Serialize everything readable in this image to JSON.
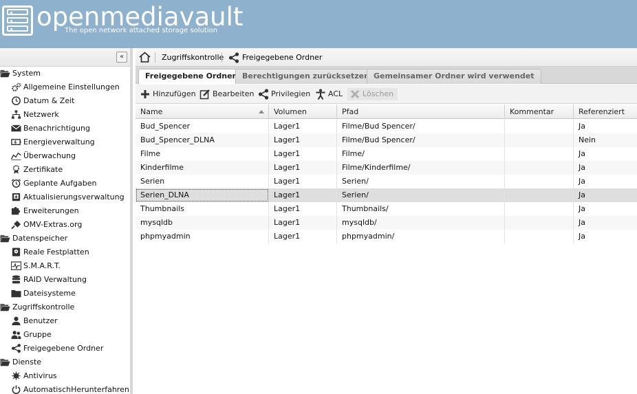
{
  "header": {
    "brand": "openmediavault",
    "tagline": "The open network attached storage solution"
  },
  "sidebar": {
    "collapse_label": "«",
    "groups": [
      {
        "label": "System",
        "items": [
          {
            "label": "Allgemeine Einstellungen",
            "icon": "gears-icon"
          },
          {
            "label": "Datum & Zeit",
            "icon": "clock-icon"
          },
          {
            "label": "Netzwerk",
            "icon": "network-icon"
          },
          {
            "label": "Benachrichtigung",
            "icon": "envelope-icon"
          },
          {
            "label": "Energieverwaltung",
            "icon": "battery-icon"
          },
          {
            "label": "Überwachung",
            "icon": "chart-icon"
          },
          {
            "label": "Zertifikate",
            "icon": "certificate-icon"
          },
          {
            "label": "Geplante Aufgaben",
            "icon": "alarm-clock-icon"
          },
          {
            "label": "Aktualisierungsverwaltung",
            "icon": "update-icon"
          },
          {
            "label": "Erweiterungen",
            "icon": "puzzle-icon"
          },
          {
            "label": "OMV-Extras.org",
            "icon": "plug-icon"
          }
        ]
      },
      {
        "label": "Datenspeicher",
        "items": [
          {
            "label": "Reale Festplatten",
            "icon": "disk-icon"
          },
          {
            "label": "S.M.A.R.T.",
            "icon": "smart-icon"
          },
          {
            "label": "RAID Verwaltung",
            "icon": "raid-icon"
          },
          {
            "label": "Dateisysteme",
            "icon": "folder-icon"
          }
        ]
      },
      {
        "label": "Zugriffskontrolle",
        "items": [
          {
            "label": "Benutzer",
            "icon": "user-icon"
          },
          {
            "label": "Gruppe",
            "icon": "group-icon"
          },
          {
            "label": "Freigegebene Ordner",
            "icon": "share-icon"
          }
        ]
      },
      {
        "label": "Dienste",
        "items": [
          {
            "label": "Antivirus",
            "icon": "virus-icon"
          },
          {
            "label": "AutomatischHerunterfahren",
            "icon": "power-icon"
          }
        ]
      }
    ]
  },
  "breadcrumb": {
    "section": "Zugriffskontrolle",
    "page": "Freigegebene Ordner"
  },
  "tabs": [
    {
      "label": "Freigegebene Ordner",
      "active": true
    },
    {
      "label": "Berechtigungen zurücksetzen",
      "active": false
    },
    {
      "label": "Gemeinsamer Ordner wird verwendet",
      "active": false
    }
  ],
  "toolbar": {
    "add": "Hinzufügen",
    "edit": "Bearbeiten",
    "privileges": "Privilegien",
    "acl": "ACL",
    "delete": "Löschen"
  },
  "grid": {
    "columns": [
      "Name",
      "Volumen",
      "Pfad",
      "Kommentar",
      "Referenziert"
    ],
    "rows": [
      {
        "name": "Bud_Spencer",
        "volume": "Lager1",
        "path": "Filme/Bud Spencer/",
        "comment": "",
        "referenced": "Ja"
      },
      {
        "name": "Bud_Spencer_DLNA",
        "volume": "Lager1",
        "path": "Filme/Bud Spencer/",
        "comment": "",
        "referenced": "Nein"
      },
      {
        "name": "Filme",
        "volume": "Lager1",
        "path": "Filme/",
        "comment": "",
        "referenced": "Ja"
      },
      {
        "name": "Kinderfilme",
        "volume": "Lager1",
        "path": "Filme/Kinderfilme/",
        "comment": "",
        "referenced": "Ja"
      },
      {
        "name": "Serien",
        "volume": "Lager1",
        "path": "Serien/",
        "comment": "",
        "referenced": "Ja"
      },
      {
        "name": "Serien_DLNA",
        "volume": "Lager1",
        "path": "Serien/",
        "comment": "",
        "referenced": "Ja"
      },
      {
        "name": "Thumbnails",
        "volume": "Lager1",
        "path": "Thumbnails/",
        "comment": "",
        "referenced": "Ja"
      },
      {
        "name": "mysqldb",
        "volume": "Lager1",
        "path": "mysqldb/",
        "comment": "",
        "referenced": "Ja"
      },
      {
        "name": "phpmyadmin",
        "volume": "Lager1",
        "path": "phpmyadmin/",
        "comment": "",
        "referenced": "Ja"
      }
    ]
  }
}
